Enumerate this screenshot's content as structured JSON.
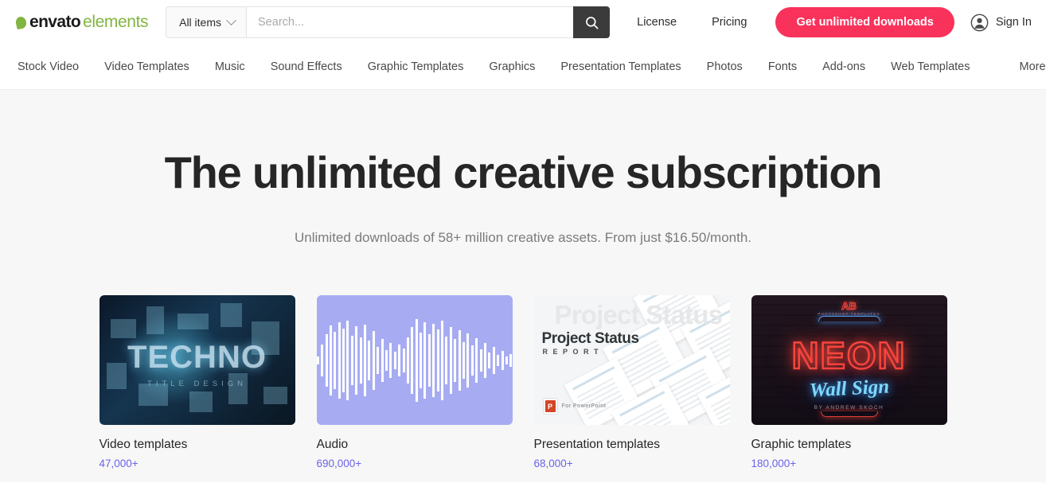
{
  "header": {
    "logo": {
      "brand": "envato",
      "product": "elements",
      "leaf_icon": "leaf-icon"
    },
    "search": {
      "scope_label": "All items",
      "scope_chevron_icon": "chevron-down-icon",
      "placeholder": "Search...",
      "value": "",
      "button_icon": "search-icon"
    },
    "links": [
      {
        "label": "License"
      },
      {
        "label": "Pricing"
      }
    ],
    "cta_label": "Get unlimited downloads",
    "signin": {
      "label": "Sign In",
      "avatar_icon": "user-avatar-icon"
    },
    "accent_color": "#F9325B"
  },
  "nav": {
    "items": [
      {
        "label": "Stock Video"
      },
      {
        "label": "Video Templates"
      },
      {
        "label": "Music"
      },
      {
        "label": "Sound Effects"
      },
      {
        "label": "Graphic Templates"
      },
      {
        "label": "Graphics"
      },
      {
        "label": "Presentation Templates"
      },
      {
        "label": "Photos"
      },
      {
        "label": "Fonts"
      },
      {
        "label": "Add-ons"
      },
      {
        "label": "Web Templates"
      }
    ],
    "more_label": "More"
  },
  "hero": {
    "title": "The unlimited creative subscription",
    "subtitle": "Unlimited downloads of 58+ million creative assets. From just $16.50/month."
  },
  "categories": [
    {
      "title": "Video templates",
      "count": "47,000+",
      "thumb": {
        "kind": "techno",
        "word": "TECHNO",
        "sub": "TITLE DESIGN"
      }
    },
    {
      "title": "Audio",
      "count": "690,000+",
      "thumb": {
        "kind": "audio",
        "bg_color": "#A7ACF2"
      }
    },
    {
      "title": "Presentation templates",
      "count": "68,000+",
      "thumb": {
        "kind": "presentation",
        "ghost": "Project Status",
        "title": "Project Status",
        "sub": "REPORT",
        "badge": "For PowerPoint"
      }
    },
    {
      "title": "Graphic templates",
      "count": "180,000+",
      "thumb": {
        "kind": "neon",
        "mono": "AB",
        "tag": "PHOTOSHOP TEMPLATES",
        "word": "NEON",
        "script": "Wall Sign",
        "by": "BY ANDREW SKOCH"
      }
    }
  ],
  "colors": {
    "count_text": "#6C63E8",
    "brand_green": "#82B541",
    "hero_bg": "#f7f7f7"
  }
}
